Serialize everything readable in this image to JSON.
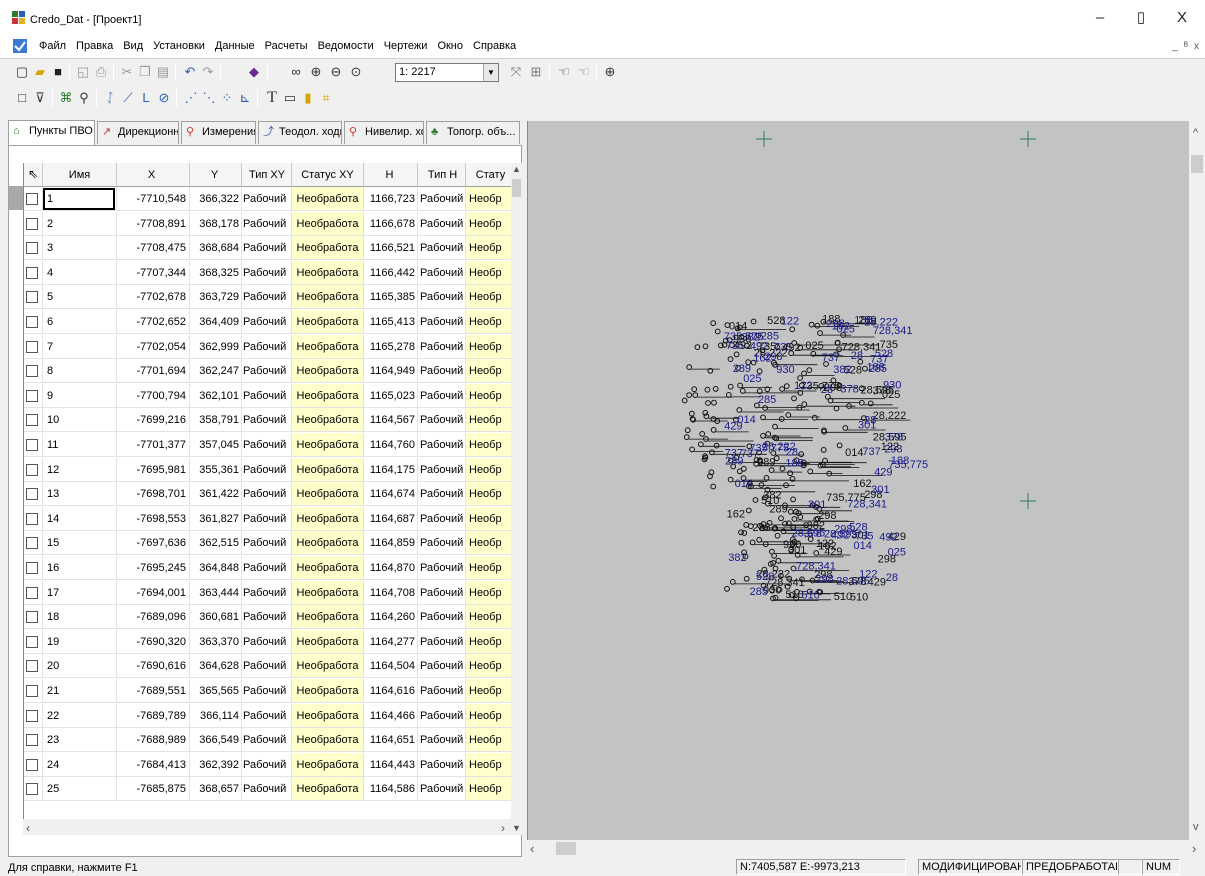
{
  "window": {
    "title": "Credo_Dat - [Проект1]",
    "minimize": "–",
    "maximize": "▯",
    "close": "X"
  },
  "menu": {
    "items": [
      "Файл",
      "Правка",
      "Вид",
      "Установки",
      "Данные",
      "Расчеты",
      "Ведомости",
      "Чертежи",
      "Окно",
      "Справка"
    ],
    "mdi": [
      "_",
      "ᴮ",
      "x"
    ]
  },
  "toolbar": {
    "scale_value": "1: 2217",
    "text_tool": "T"
  },
  "tabs": [
    {
      "label": "Пункты ПВО",
      "icon": "survey-points-icon"
    },
    {
      "label": "Дирекционн...",
      "icon": "direction-angle-icon"
    },
    {
      "label": "Измерения",
      "icon": "tripod-icon"
    },
    {
      "label": "Теодол. ходы",
      "icon": "traverse-icon"
    },
    {
      "label": "Нивелир. хо...",
      "icon": "level-icon"
    },
    {
      "label": "Топогр. объ...",
      "icon": "tree-icon"
    }
  ],
  "table": {
    "headers": {
      "name": "Имя",
      "x": "X",
      "y": "Y",
      "type_xy": "Тип XY",
      "status_xy": "Статус XY",
      "h": "H",
      "type_h": "Тип H",
      "status_h": "Стату"
    },
    "rows": [
      {
        "name": "1",
        "x": "-7710,548",
        "y": "366,322",
        "type_xy": "Рабочий",
        "status_xy": "Необработа",
        "h": "1166,723",
        "type_h": "Рабочий",
        "status_h": "Необр"
      },
      {
        "name": "2",
        "x": "-7708,891",
        "y": "368,178",
        "type_xy": "Рабочий",
        "status_xy": "Необработа",
        "h": "1166,678",
        "type_h": "Рабочий",
        "status_h": "Необр"
      },
      {
        "name": "3",
        "x": "-7708,475",
        "y": "368,684",
        "type_xy": "Рабочий",
        "status_xy": "Необработа",
        "h": "1166,521",
        "type_h": "Рабочий",
        "status_h": "Необр"
      },
      {
        "name": "4",
        "x": "-7707,344",
        "y": "368,325",
        "type_xy": "Рабочий",
        "status_xy": "Необработа",
        "h": "1166,442",
        "type_h": "Рабочий",
        "status_h": "Необр"
      },
      {
        "name": "5",
        "x": "-7702,678",
        "y": "363,729",
        "type_xy": "Рабочий",
        "status_xy": "Необработа",
        "h": "1165,385",
        "type_h": "Рабочий",
        "status_h": "Необр"
      },
      {
        "name": "6",
        "x": "-7702,652",
        "y": "364,409",
        "type_xy": "Рабочий",
        "status_xy": "Необработа",
        "h": "1165,413",
        "type_h": "Рабочий",
        "status_h": "Необр"
      },
      {
        "name": "7",
        "x": "-7702,054",
        "y": "362,999",
        "type_xy": "Рабочий",
        "status_xy": "Необработа",
        "h": "1165,278",
        "type_h": "Рабочий",
        "status_h": "Необр"
      },
      {
        "name": "8",
        "x": "-7701,694",
        "y": "362,247",
        "type_xy": "Рабочий",
        "status_xy": "Необработа",
        "h": "1164,949",
        "type_h": "Рабочий",
        "status_h": "Необр"
      },
      {
        "name": "9",
        "x": "-7700,794",
        "y": "362,101",
        "type_xy": "Рабочий",
        "status_xy": "Необработа",
        "h": "1165,023",
        "type_h": "Рабочий",
        "status_h": "Необр"
      },
      {
        "name": "10",
        "x": "-7699,216",
        "y": "358,791",
        "type_xy": "Рабочий",
        "status_xy": "Необработа",
        "h": "1164,567",
        "type_h": "Рабочий",
        "status_h": "Необр"
      },
      {
        "name": "11",
        "x": "-7701,377",
        "y": "357,045",
        "type_xy": "Рабочий",
        "status_xy": "Необработа",
        "h": "1164,760",
        "type_h": "Рабочий",
        "status_h": "Необр"
      },
      {
        "name": "12",
        "x": "-7695,981",
        "y": "355,361",
        "type_xy": "Рабочий",
        "status_xy": "Необработа",
        "h": "1164,175",
        "type_h": "Рабочий",
        "status_h": "Необр"
      },
      {
        "name": "13",
        "x": "-7698,701",
        "y": "361,422",
        "type_xy": "Рабочий",
        "status_xy": "Необработа",
        "h": "1164,674",
        "type_h": "Рабочий",
        "status_h": "Необр"
      },
      {
        "name": "14",
        "x": "-7698,553",
        "y": "361,827",
        "type_xy": "Рабочий",
        "status_xy": "Необработа",
        "h": "1164,687",
        "type_h": "Рабочий",
        "status_h": "Необр"
      },
      {
        "name": "15",
        "x": "-7697,636",
        "y": "362,515",
        "type_xy": "Рабочий",
        "status_xy": "Необработа",
        "h": "1164,859",
        "type_h": "Рабочий",
        "status_h": "Необр"
      },
      {
        "name": "16",
        "x": "-7695,245",
        "y": "364,848",
        "type_xy": "Рабочий",
        "status_xy": "Необработа",
        "h": "1164,870",
        "type_h": "Рабочий",
        "status_h": "Необр"
      },
      {
        "name": "17",
        "x": "-7694,001",
        "y": "363,444",
        "type_xy": "Рабочий",
        "status_xy": "Необработа",
        "h": "1164,708",
        "type_h": "Рабочий",
        "status_h": "Необр"
      },
      {
        "name": "18",
        "x": "-7689,096",
        "y": "360,681",
        "type_xy": "Рабочий",
        "status_xy": "Необработа",
        "h": "1164,260",
        "type_h": "Рабочий",
        "status_h": "Необр"
      },
      {
        "name": "19",
        "x": "-7690,320",
        "y": "363,370",
        "type_xy": "Рабочий",
        "status_xy": "Необработа",
        "h": "1164,277",
        "type_h": "Рабочий",
        "status_h": "Необр"
      },
      {
        "name": "20",
        "x": "-7690,616",
        "y": "364,628",
        "type_xy": "Рабочий",
        "status_xy": "Необработа",
        "h": "1164,504",
        "type_h": "Рабочий",
        "status_h": "Необр"
      },
      {
        "name": "21",
        "x": "-7689,551",
        "y": "365,565",
        "type_xy": "Рабочий",
        "status_xy": "Необработа",
        "h": "1164,616",
        "type_h": "Рабочий",
        "status_h": "Необр"
      },
      {
        "name": "22",
        "x": "-7689,789",
        "y": "366,114",
        "type_xy": "Рабочий",
        "status_xy": "Необработа",
        "h": "1164,466",
        "type_h": "Рабочий",
        "status_h": "Необр"
      },
      {
        "name": "23",
        "x": "-7688,989",
        "y": "366,549",
        "type_xy": "Рабочий",
        "status_xy": "Необработа",
        "h": "1164,651",
        "type_h": "Рабочий",
        "status_h": "Необр"
      },
      {
        "name": "24",
        "x": "-7684,413",
        "y": "362,392",
        "type_xy": "Рабочий",
        "status_xy": "Необработа",
        "h": "1164,443",
        "type_h": "Рабочий",
        "status_h": "Необр"
      },
      {
        "name": "25",
        "x": "-7685,875",
        "y": "368,657",
        "type_xy": "Рабочий",
        "status_xy": "Необработа",
        "h": "1164,586",
        "type_h": "Рабочий",
        "status_h": "Необр"
      }
    ]
  },
  "view": {
    "background": "#c3c3c3",
    "label_color": "#1a1a8c",
    "cross_color": "#2a7a6a",
    "point_labels": [
      "298",
      "298",
      "378",
      "382",
      "728,341",
      "735",
      "301",
      "28,222",
      "28,595",
      "28",
      "528",
      "737",
      "429",
      "014",
      "188",
      "122",
      "735,775",
      "492",
      "930",
      "285",
      "289",
      "162",
      "025",
      "510"
    ]
  },
  "status": {
    "help": "Для справки, нажмите F1",
    "coords": "N:7405,587 E:-9973,213",
    "modified": "МОДИФИЦИРОВАН",
    "preprocessed": "ПРЕДОБРАБОТАН",
    "num": "NUM"
  }
}
